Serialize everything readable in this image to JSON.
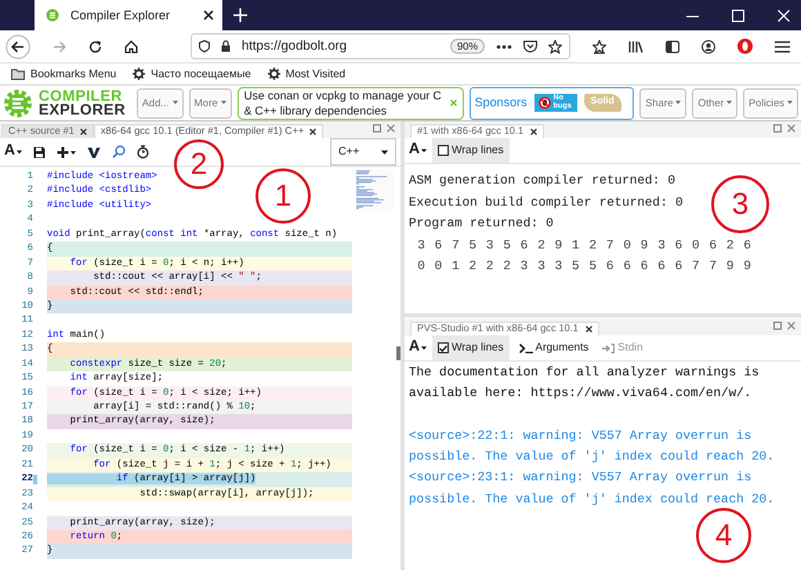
{
  "browser": {
    "tab_title": "Compiler Explorer",
    "url": "https://godbolt.org",
    "zoom": "90%"
  },
  "bookmarks": [
    {
      "kind": "folder",
      "label": "Bookmarks Menu"
    },
    {
      "kind": "gear",
      "label": "Часто посещаемые"
    },
    {
      "kind": "gear",
      "label": "Most Visited"
    }
  ],
  "header": {
    "logo": [
      "COMPILER",
      "EXPLORER"
    ],
    "menus_left": [
      "Add...",
      "More"
    ],
    "notice": [
      {
        "kind": "text",
        "text": "Use "
      },
      {
        "kind": "link",
        "text": "conan"
      },
      {
        "kind": "text",
        "text": " or "
      },
      {
        "kind": "link",
        "text": "vcpkg"
      },
      {
        "kind": "text",
        "text": " to manage your C & C++ library dependencies"
      }
    ],
    "sponsors": {
      "label": "Sponsors",
      "logos": [
        "No bugs",
        "Solid"
      ]
    },
    "menus_right": [
      "Share",
      "Other",
      "Policies"
    ]
  },
  "editor": {
    "tabs": [
      {
        "label": "C++ source #1",
        "selected": false
      },
      {
        "label": "x86-64 gcc 10.1 (Editor #1, Compiler #1) C++",
        "selected": true
      }
    ],
    "font_button": "A",
    "language": "C++",
    "lines": [
      {
        "number": "1",
        "color": "#ffffff",
        "selected": false,
        "segments": [
          {
            "kind": "kw",
            "text": "#include <iostream>"
          }
        ]
      },
      {
        "number": "2",
        "color": "#ffffff",
        "selected": false,
        "segments": [
          {
            "kind": "kw",
            "text": "#include <cstdlib>"
          }
        ]
      },
      {
        "number": "3",
        "color": "#ffffff",
        "selected": false,
        "segments": [
          {
            "kind": "kw",
            "text": "#include <utility>"
          }
        ]
      },
      {
        "number": "4",
        "color": "#ffffff",
        "selected": false
      },
      {
        "number": "5",
        "color": "#ffffff",
        "selected": false,
        "segments": [
          {
            "kind": "kw",
            "text": "void"
          },
          {
            "kind": "plain",
            "text": " print_array("
          },
          {
            "kind": "kw",
            "text": "const"
          },
          {
            "kind": "kw",
            "text": " int"
          },
          {
            "kind": "plain",
            "text": " *array, "
          },
          {
            "kind": "kw",
            "text": "const"
          },
          {
            "kind": "plain",
            "text": " size_t n)"
          }
        ]
      },
      {
        "number": "6",
        "color": "#d9efe9",
        "selected": false,
        "segments": [
          {
            "kind": "plain",
            "text": "{"
          }
        ]
      },
      {
        "number": "7",
        "color": "#fdfbe1",
        "selected": false,
        "segments": [
          {
            "kind": "kw",
            "text": "    for"
          },
          {
            "kind": "plain",
            "text": " (size_t i = "
          },
          {
            "kind": "num",
            "text": "0"
          },
          {
            "kind": "plain",
            "text": "; i < n; i++)"
          }
        ]
      },
      {
        "number": "8",
        "color": "#e8e7f1",
        "selected": false,
        "segments": [
          {
            "kind": "plain",
            "text": "        std::cout << array[i] << "
          },
          {
            "kind": "str",
            "text": "\" \""
          },
          {
            "kind": "plain",
            "text": ";"
          }
        ]
      },
      {
        "number": "9",
        "color": "#fdd6cf",
        "selected": false,
        "segments": [
          {
            "kind": "plain",
            "text": "    std::cout << std::endl;"
          }
        ]
      },
      {
        "number": "10",
        "color": "#d5e3ee",
        "selected": false,
        "segments": [
          {
            "kind": "plain",
            "text": "}"
          }
        ]
      },
      {
        "number": "11",
        "color": "#ffffff",
        "selected": false
      },
      {
        "number": "12",
        "color": "#ffffff",
        "selected": false,
        "segments": [
          {
            "kind": "kw",
            "text": "int"
          },
          {
            "kind": "plain",
            "text": " main()"
          }
        ]
      },
      {
        "number": "13",
        "color": "#fde4cd",
        "selected": false,
        "segments": [
          {
            "kind": "plain",
            "text": "{"
          }
        ]
      },
      {
        "number": "14",
        "color": "#e3f1d5",
        "selected": false,
        "segments": [
          {
            "kind": "kw",
            "text": "    constexpr"
          },
          {
            "kind": "plain",
            "text": " size_t size = "
          },
          {
            "kind": "num",
            "text": "20"
          },
          {
            "kind": "plain",
            "text": ";"
          }
        ]
      },
      {
        "number": "15",
        "color": "#ffffff",
        "selected": false,
        "segments": [
          {
            "kind": "kw",
            "text": "    int"
          },
          {
            "kind": "plain",
            "text": " array[size];"
          }
        ]
      },
      {
        "number": "16",
        "color": "#fdeef2",
        "selected": false,
        "segments": [
          {
            "kind": "kw",
            "text": "    for"
          },
          {
            "kind": "plain",
            "text": " (size_t i = "
          },
          {
            "kind": "num",
            "text": "0"
          },
          {
            "kind": "plain",
            "text": "; i < size; i++)"
          }
        ]
      },
      {
        "number": "17",
        "color": "#f3f3f3",
        "selected": false,
        "segments": [
          {
            "kind": "plain",
            "text": "        array[i] = std::rand() % "
          },
          {
            "kind": "num",
            "text": "10"
          },
          {
            "kind": "plain",
            "text": ";"
          }
        ]
      },
      {
        "number": "18",
        "color": "#ead6ea",
        "selected": false,
        "segments": [
          {
            "kind": "plain",
            "text": "    print_array(array, size);"
          }
        ]
      },
      {
        "number": "19",
        "color": "#ffffff",
        "selected": false
      },
      {
        "number": "20",
        "color": "#eef6ea",
        "selected": false,
        "segments": [
          {
            "kind": "kw",
            "text": "    for"
          },
          {
            "kind": "plain",
            "text": " (size_t i = "
          },
          {
            "kind": "num",
            "text": "0"
          },
          {
            "kind": "plain",
            "text": "; i < size - "
          },
          {
            "kind": "num",
            "text": "1"
          },
          {
            "kind": "plain",
            "text": "; i++)"
          }
        ]
      },
      {
        "number": "21",
        "color": "#fdf9df",
        "selected": false,
        "segments": [
          {
            "kind": "kw",
            "text": "        for"
          },
          {
            "kind": "plain",
            "text": " (size_t j = i + "
          },
          {
            "kind": "num",
            "text": "1"
          },
          {
            "kind": "plain",
            "text": "; j < size + "
          },
          {
            "kind": "num",
            "text": "1"
          },
          {
            "kind": "plain",
            "text": "; j++)"
          }
        ]
      },
      {
        "number": "22",
        "color": "#d8eeeb",
        "selected": true,
        "segments": [
          {
            "kind": "kw",
            "text": "            if"
          },
          {
            "kind": "plain",
            "text": " (array[i] > array[j])"
          }
        ]
      },
      {
        "number": "23",
        "color": "#fdf9df",
        "selected": false,
        "segments": [
          {
            "kind": "plain",
            "text": "                std::swap(array[i], array[j]);"
          }
        ]
      },
      {
        "number": "24",
        "color": "#ffffff",
        "selected": false
      },
      {
        "number": "25",
        "color": "#e8e7f1",
        "selected": false,
        "segments": [
          {
            "kind": "plain",
            "text": "    print_array(array, size);"
          }
        ]
      },
      {
        "number": "26",
        "color": "#fdd6cf",
        "selected": false,
        "segments": [
          {
            "kind": "kw",
            "text": "    return"
          },
          {
            "kind": "num",
            "text": " 0"
          },
          {
            "kind": "plain",
            "text": ";"
          }
        ]
      },
      {
        "number": "27",
        "color": "#d5e3ee",
        "selected": false,
        "segments": [
          {
            "kind": "plain",
            "text": "}"
          }
        ]
      }
    ]
  },
  "output": {
    "tab": "#1 with x86-64 gcc 10.1",
    "font_button": "A",
    "wrap_label": "Wrap lines",
    "wrap_lines": false,
    "lines": [
      {
        "kind": "status",
        "text": "ASM generation compiler returned: 0"
      },
      {
        "kind": "status",
        "text": "Execution build compiler returned: 0"
      },
      {
        "kind": "status",
        "text": "Program returned: 0"
      },
      {
        "kind": "stdout",
        "text": " 3 6 7 5 3 5 6 2 9 1 2 7 0 9 3 6 0 6 2 6"
      },
      {
        "kind": "stdout",
        "text": " 0 0 1 2 2 2 3 3 3 5 5 6 6 6 6 6 7 7 9 9"
      }
    ]
  },
  "analyzer": {
    "tab": "PVS-Studio #1 with x86-64 gcc 10.1",
    "font_button": "A",
    "wrap_label": "Wrap lines",
    "wrap_lines": true,
    "tools": [
      {
        "kind": "terminal",
        "label": "Arguments",
        "disabled": false
      },
      {
        "kind": "input",
        "label": "Stdin",
        "disabled": true
      }
    ],
    "messages": [
      {
        "kind": "info",
        "text": "The documentation for all analyzer warnings is available here: https://www.viva64.com/en/w/."
      },
      {
        "kind": "warning",
        "text": "<source>:22:1: warning: V557 Array overrun is possible. The value of 'j' index could reach 20."
      },
      {
        "kind": "warning",
        "text": "<source>:23:1: warning: V557 Array overrun is possible. The value of 'j' index could reach 20."
      }
    ]
  },
  "annotations": [
    "1",
    "2",
    "3",
    "4"
  ]
}
